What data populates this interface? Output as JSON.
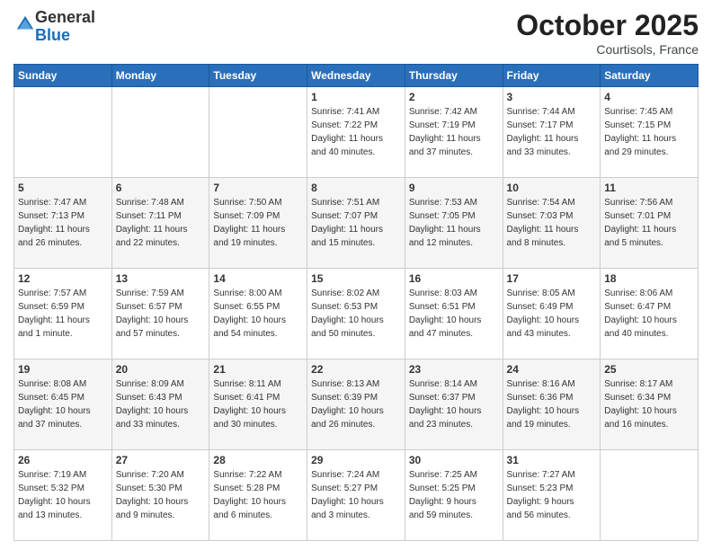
{
  "header": {
    "logo_general": "General",
    "logo_blue": "Blue",
    "month": "October 2025",
    "location": "Courtisols, France"
  },
  "days_of_week": [
    "Sunday",
    "Monday",
    "Tuesday",
    "Wednesday",
    "Thursday",
    "Friday",
    "Saturday"
  ],
  "weeks": [
    [
      {
        "day": "",
        "info": ""
      },
      {
        "day": "",
        "info": ""
      },
      {
        "day": "",
        "info": ""
      },
      {
        "day": "1",
        "info": "Sunrise: 7:41 AM\nSunset: 7:22 PM\nDaylight: 11 hours\nand 40 minutes."
      },
      {
        "day": "2",
        "info": "Sunrise: 7:42 AM\nSunset: 7:19 PM\nDaylight: 11 hours\nand 37 minutes."
      },
      {
        "day": "3",
        "info": "Sunrise: 7:44 AM\nSunset: 7:17 PM\nDaylight: 11 hours\nand 33 minutes."
      },
      {
        "day": "4",
        "info": "Sunrise: 7:45 AM\nSunset: 7:15 PM\nDaylight: 11 hours\nand 29 minutes."
      }
    ],
    [
      {
        "day": "5",
        "info": "Sunrise: 7:47 AM\nSunset: 7:13 PM\nDaylight: 11 hours\nand 26 minutes."
      },
      {
        "day": "6",
        "info": "Sunrise: 7:48 AM\nSunset: 7:11 PM\nDaylight: 11 hours\nand 22 minutes."
      },
      {
        "day": "7",
        "info": "Sunrise: 7:50 AM\nSunset: 7:09 PM\nDaylight: 11 hours\nand 19 minutes."
      },
      {
        "day": "8",
        "info": "Sunrise: 7:51 AM\nSunset: 7:07 PM\nDaylight: 11 hours\nand 15 minutes."
      },
      {
        "day": "9",
        "info": "Sunrise: 7:53 AM\nSunset: 7:05 PM\nDaylight: 11 hours\nand 12 minutes."
      },
      {
        "day": "10",
        "info": "Sunrise: 7:54 AM\nSunset: 7:03 PM\nDaylight: 11 hours\nand 8 minutes."
      },
      {
        "day": "11",
        "info": "Sunrise: 7:56 AM\nSunset: 7:01 PM\nDaylight: 11 hours\nand 5 minutes."
      }
    ],
    [
      {
        "day": "12",
        "info": "Sunrise: 7:57 AM\nSunset: 6:59 PM\nDaylight: 11 hours\nand 1 minute."
      },
      {
        "day": "13",
        "info": "Sunrise: 7:59 AM\nSunset: 6:57 PM\nDaylight: 10 hours\nand 57 minutes."
      },
      {
        "day": "14",
        "info": "Sunrise: 8:00 AM\nSunset: 6:55 PM\nDaylight: 10 hours\nand 54 minutes."
      },
      {
        "day": "15",
        "info": "Sunrise: 8:02 AM\nSunset: 6:53 PM\nDaylight: 10 hours\nand 50 minutes."
      },
      {
        "day": "16",
        "info": "Sunrise: 8:03 AM\nSunset: 6:51 PM\nDaylight: 10 hours\nand 47 minutes."
      },
      {
        "day": "17",
        "info": "Sunrise: 8:05 AM\nSunset: 6:49 PM\nDaylight: 10 hours\nand 43 minutes."
      },
      {
        "day": "18",
        "info": "Sunrise: 8:06 AM\nSunset: 6:47 PM\nDaylight: 10 hours\nand 40 minutes."
      }
    ],
    [
      {
        "day": "19",
        "info": "Sunrise: 8:08 AM\nSunset: 6:45 PM\nDaylight: 10 hours\nand 37 minutes."
      },
      {
        "day": "20",
        "info": "Sunrise: 8:09 AM\nSunset: 6:43 PM\nDaylight: 10 hours\nand 33 minutes."
      },
      {
        "day": "21",
        "info": "Sunrise: 8:11 AM\nSunset: 6:41 PM\nDaylight: 10 hours\nand 30 minutes."
      },
      {
        "day": "22",
        "info": "Sunrise: 8:13 AM\nSunset: 6:39 PM\nDaylight: 10 hours\nand 26 minutes."
      },
      {
        "day": "23",
        "info": "Sunrise: 8:14 AM\nSunset: 6:37 PM\nDaylight: 10 hours\nand 23 minutes."
      },
      {
        "day": "24",
        "info": "Sunrise: 8:16 AM\nSunset: 6:36 PM\nDaylight: 10 hours\nand 19 minutes."
      },
      {
        "day": "25",
        "info": "Sunrise: 8:17 AM\nSunset: 6:34 PM\nDaylight: 10 hours\nand 16 minutes."
      }
    ],
    [
      {
        "day": "26",
        "info": "Sunrise: 7:19 AM\nSunset: 5:32 PM\nDaylight: 10 hours\nand 13 minutes."
      },
      {
        "day": "27",
        "info": "Sunrise: 7:20 AM\nSunset: 5:30 PM\nDaylight: 10 hours\nand 9 minutes."
      },
      {
        "day": "28",
        "info": "Sunrise: 7:22 AM\nSunset: 5:28 PM\nDaylight: 10 hours\nand 6 minutes."
      },
      {
        "day": "29",
        "info": "Sunrise: 7:24 AM\nSunset: 5:27 PM\nDaylight: 10 hours\nand 3 minutes."
      },
      {
        "day": "30",
        "info": "Sunrise: 7:25 AM\nSunset: 5:25 PM\nDaylight: 9 hours\nand 59 minutes."
      },
      {
        "day": "31",
        "info": "Sunrise: 7:27 AM\nSunset: 5:23 PM\nDaylight: 9 hours\nand 56 minutes."
      },
      {
        "day": "",
        "info": ""
      }
    ]
  ]
}
